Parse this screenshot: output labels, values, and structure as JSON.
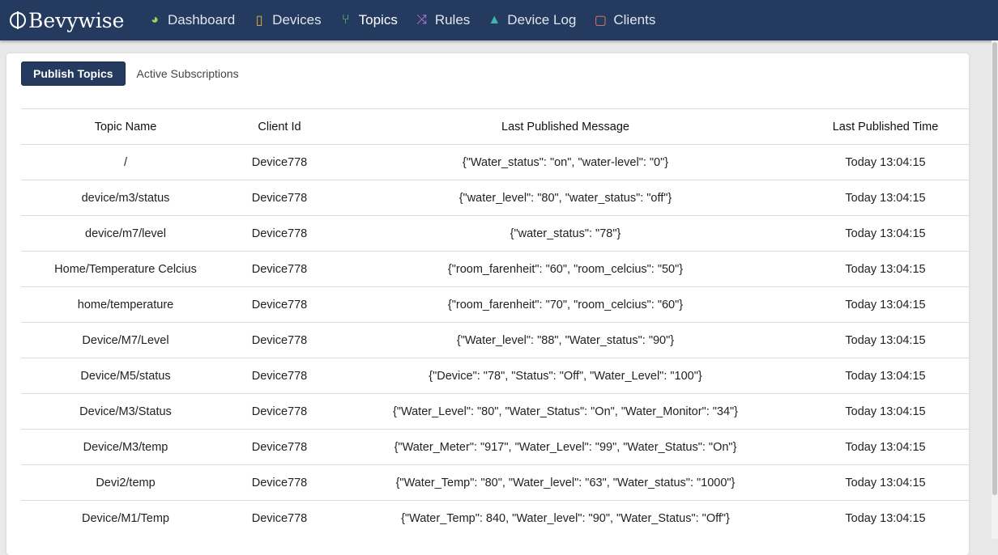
{
  "brand": "Bevywise",
  "nav": [
    {
      "label": "Dashboard",
      "icon": "dashboard-gauge-icon",
      "glyph": "◕",
      "color": "#a3d45a"
    },
    {
      "label": "Devices",
      "icon": "devices-icon",
      "glyph": "▯",
      "color": "#e3b23c"
    },
    {
      "label": "Topics",
      "icon": "topics-branch-icon",
      "glyph": "⑂",
      "color": "#6fd07a"
    },
    {
      "label": "Rules",
      "icon": "rules-shuffle-icon",
      "glyph": "⤨",
      "color": "#c27be0"
    },
    {
      "label": "Device Log",
      "icon": "device-log-warning-icon",
      "glyph": "▲",
      "color": "#3fb6a8"
    },
    {
      "label": "Clients",
      "icon": "clients-file-icon",
      "glyph": "▢",
      "color": "#e07b6a"
    }
  ],
  "tabs": [
    "Publish Topics",
    "Active Subscriptions"
  ],
  "table": {
    "headers": [
      "Topic Name",
      "Client Id",
      "Last Published Message",
      "Last Published Time"
    ],
    "rows": [
      [
        "/",
        "Device778",
        "{\"Water_status\": \"on\", \"water-level\": \"0\"}",
        "Today 13:04:15"
      ],
      [
        "device/m3/status",
        "Device778",
        "{\"water_level\": \"80\", \"water_status\": \"off\"}",
        "Today 13:04:15"
      ],
      [
        "device/m7/level",
        "Device778",
        "{\"water_status\": \"78\"}",
        "Today 13:04:15"
      ],
      [
        "Home/Temperature Celcius",
        "Device778",
        "{\"room_farenheit\": \"60\", \"room_celcius\": \"50\"}",
        "Today 13:04:15"
      ],
      [
        "home/temperature",
        "Device778",
        "{\"room_farenheit\": \"70\", \"room_celcius\": \"60\"}",
        "Today 13:04:15"
      ],
      [
        "Device/M7/Level",
        "Device778",
        "{\"Water_level\": \"88\", \"Water_status\": \"90\"}",
        "Today 13:04:15"
      ],
      [
        "Device/M5/status",
        "Device778",
        "{\"Device\": \"78\", \"Status\": \"Off\", \"Water_Level\": \"100\"}",
        "Today 13:04:15"
      ],
      [
        "Device/M3/Status",
        "Device778",
        "{\"Water_Level\": \"80\", \"Water_Status\": \"On\", \"Water_Monitor\": \"34\"}",
        "Today 13:04:15"
      ],
      [
        "Device/M3/temp",
        "Device778",
        "{\"Water_Meter\": \"917\", \"Water_Level\": \"99\", \"Water_Status\": \"On\"}",
        "Today 13:04:15"
      ],
      [
        "Devi2/temp",
        "Device778",
        "{\"Water_Temp\": \"80\", \"Water_level\": \"63\", \"Water_status\": \"1000\"}",
        "Today 13:04:15"
      ],
      [
        "Device/M1/Temp",
        "Device778",
        "{\"Water_Temp\": 840, \"Water_level\": \"90\", \"Water_Status\": \"Off\"}",
        "Today 13:04:15"
      ]
    ]
  }
}
